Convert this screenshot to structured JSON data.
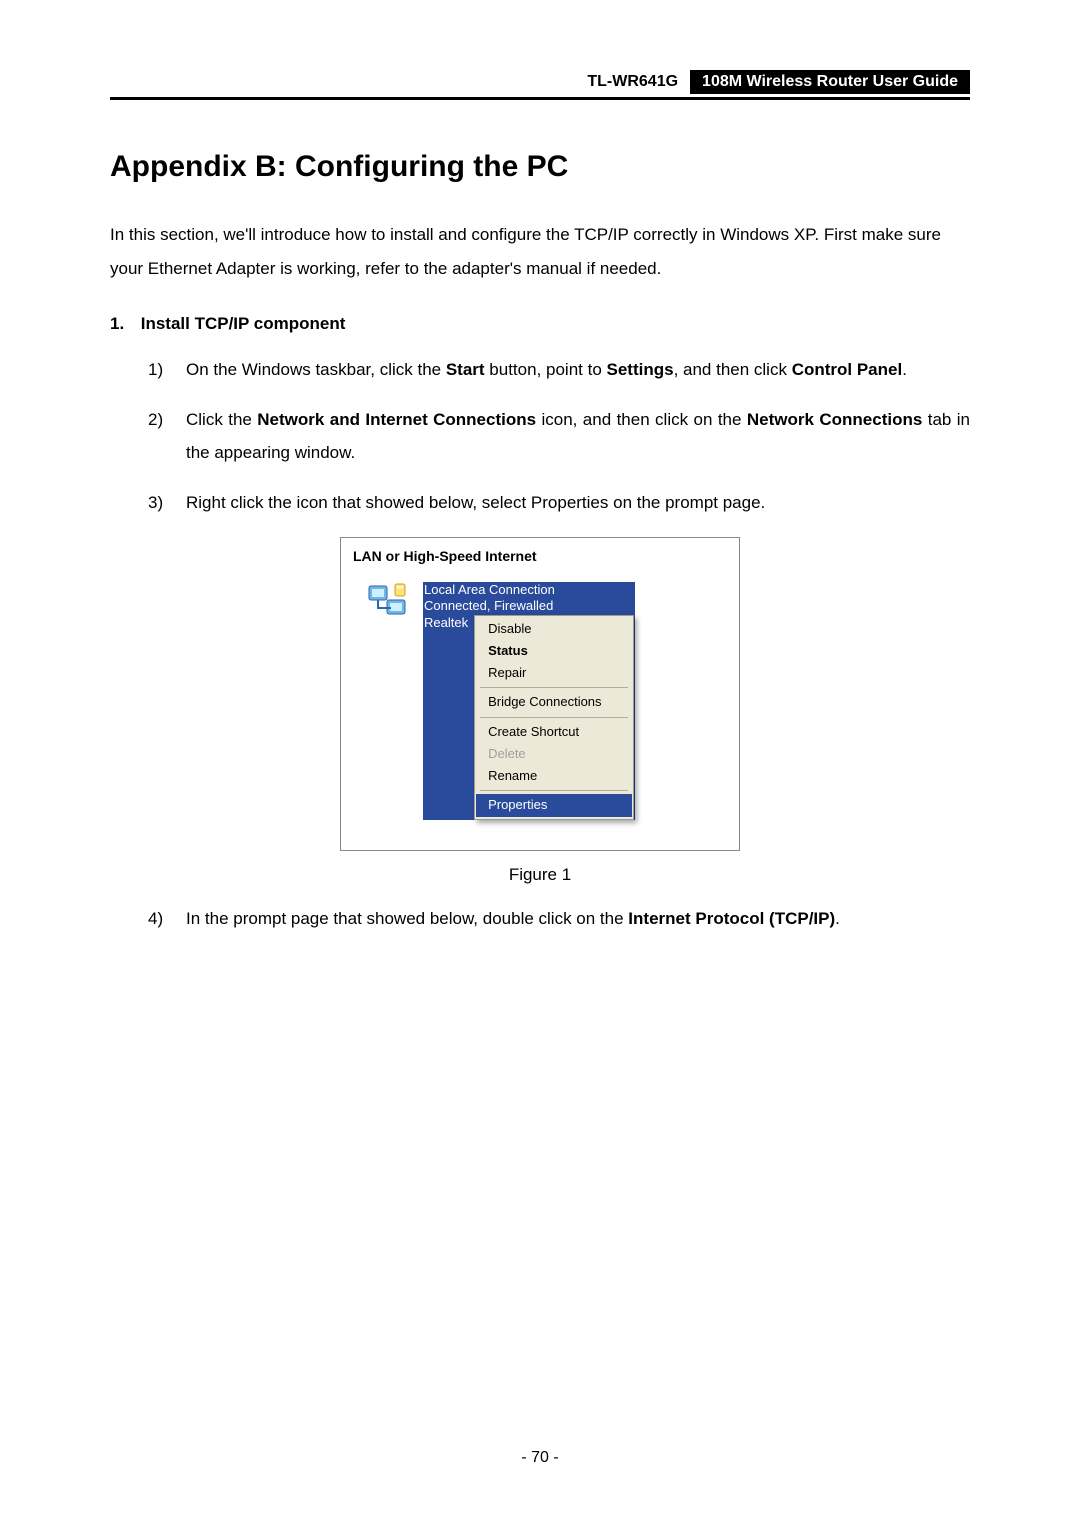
{
  "header": {
    "model": "TL-WR641G",
    "title": "108M Wireless Router User Guide"
  },
  "page_title": "Appendix B: Configuring the PC",
  "intro": "In this section, we'll introduce how to install and configure the TCP/IP correctly in Windows XP. First make sure your Ethernet Adapter is working, refer to the adapter's manual if needed.",
  "section": {
    "number": "1.",
    "heading": "Install TCP/IP component"
  },
  "steps": {
    "s1": {
      "marker": "1)",
      "t0": "On the Windows taskbar, click the ",
      "b0": "Start",
      "t1": " button, point to ",
      "b1": "Settings",
      "t2": ", and then click ",
      "b2": "Control Panel",
      "t3": "."
    },
    "s2": {
      "marker": "2)",
      "t0": "Click the ",
      "b0": "Network and Internet Connections",
      "t1": " icon, and then click on the ",
      "b1": "Network Connections",
      "t2": " tab in the appearing window."
    },
    "s3": {
      "marker": "3)",
      "t0": "Right click the icon that showed below, select Properties on the prompt page."
    },
    "s4": {
      "marker": "4)",
      "t0": "In the prompt page that showed below, double click on the ",
      "b0": "Internet Protocol (TCP/IP)",
      "t1": "."
    }
  },
  "figure": {
    "group_title": "LAN or High-Speed Internet",
    "conn_name": "Local Area Connection",
    "conn_status": "Connected, Firewalled",
    "conn_adapter": "Realtek",
    "menu": {
      "disable": "Disable",
      "status": "Status",
      "repair": "Repair",
      "bridge": "Bridge Connections",
      "shortcut": "Create Shortcut",
      "delete": "Delete",
      "rename": "Rename",
      "properties": "Properties"
    },
    "caption": "Figure 1"
  },
  "page_number": "- 70 -"
}
